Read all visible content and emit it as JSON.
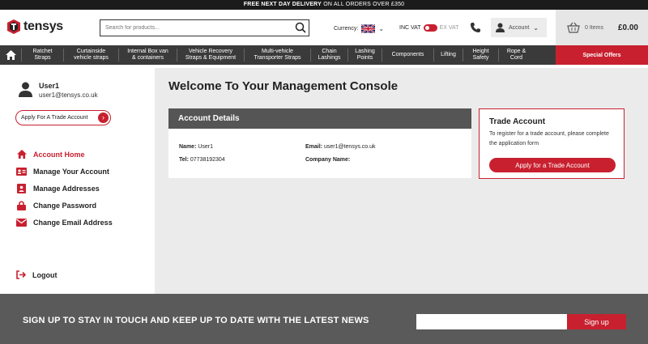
{
  "topbar": {
    "bold": "FREE NEXT DAY DELIVERY",
    "rest": " ON ALL ORDERS OVER £350"
  },
  "logo": {
    "text": "tensys"
  },
  "search": {
    "placeholder": "Search for products..."
  },
  "currency": {
    "label": "Currency:"
  },
  "vat": {
    "inc": "INC VAT",
    "ex": "EX VAT"
  },
  "account": {
    "label": "Account"
  },
  "cart": {
    "items": "0 Items",
    "total": "£0.00"
  },
  "nav": {
    "items": [
      [
        "Ratchet",
        "Straps"
      ],
      [
        "Curtainside",
        "vehicle straps"
      ],
      [
        "Internal Box van",
        "& containers"
      ],
      [
        "Vehicle Recovery",
        "Straps & Equipment"
      ],
      [
        "Multi-vehicle",
        "Transporter Straps"
      ],
      [
        "Chain",
        "Lashings"
      ],
      [
        "Lashing",
        "Points"
      ],
      [
        "Components",
        ""
      ],
      [
        "Lifting",
        ""
      ],
      [
        "Height",
        "Safety"
      ],
      [
        "Rope &",
        "Cord"
      ]
    ],
    "special": "Special Offers"
  },
  "user": {
    "name": "User1",
    "email": "user1@tensys.co.uk"
  },
  "trade_pill": "Apply For A Trade Account",
  "menu": [
    {
      "label": "Account Home",
      "active": true
    },
    {
      "label": "Manage Your Account"
    },
    {
      "label": "Manage Addresses"
    },
    {
      "label": "Change Password"
    },
    {
      "label": "Change Email Address"
    }
  ],
  "logout": "Logout",
  "main": {
    "welcome": "Welcome To Your Management Console",
    "account_details": {
      "title": "Account Details",
      "name_label": "Name:",
      "name": "User1",
      "tel_label": "Tel:",
      "tel": "07738192304",
      "email_label": "Email:",
      "email": "user1@tensys.co.uk",
      "company_label": "Company Name:",
      "company": ""
    },
    "trade_account": {
      "title": "Trade Account",
      "desc": "To register for a trade account, please complete the application form",
      "button": "Apply for a Trade Account"
    }
  },
  "footer": {
    "message": "SIGN UP TO STAY IN TOUCH AND KEEP UP TO DATE WITH THE LATEST NEWS",
    "button": "Sign up"
  },
  "colors": {
    "accent": "#c8202f",
    "dark": "#3a3a3a"
  }
}
